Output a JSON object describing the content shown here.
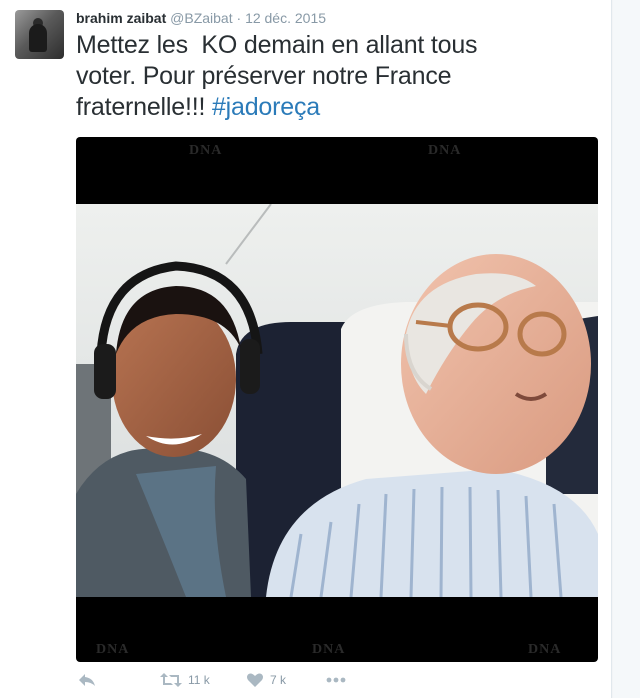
{
  "tweet": {
    "fullname": "brahim zaibat",
    "handle": "@BZaibat",
    "separator": " · ",
    "date": "12 déc. 2015",
    "text_lines": [
      "Mettez les  KO demain en allant tous",
      "voter. Pour préserver notre France",
      "fraternelle!!! "
    ],
    "hashtag": "#jadoreça"
  },
  "media": {
    "watermark": "DNA"
  },
  "actions": {
    "reply_icon": "reply-icon",
    "retweet_icon": "retweet-icon",
    "retweet_count": "11 k",
    "like_icon": "heart-icon",
    "like_count": "7 k",
    "more_icon": "more-icon"
  },
  "colors": {
    "hashtag": "#2b7bb9",
    "meta": "#8899a6",
    "action_icon": "#aab8c2"
  }
}
